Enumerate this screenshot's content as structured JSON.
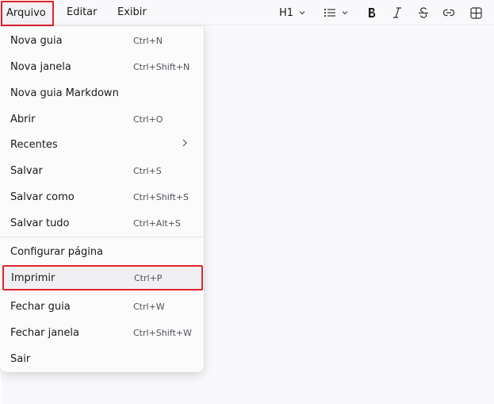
{
  "menubar": {
    "tabs": [
      {
        "label": "Arquivo"
      },
      {
        "label": "Editar"
      },
      {
        "label": "Exibir"
      }
    ]
  },
  "format_toolbar": {
    "heading_label": "H1",
    "icons": [
      "chevron-down-icon",
      "list-icon",
      "bold-icon",
      "italic-icon",
      "strikethrough-icon",
      "link-icon",
      "table-icon"
    ]
  },
  "file_menu": {
    "items": [
      {
        "label": "Nova guia",
        "shortcut": "Ctrl+N"
      },
      {
        "label": "Nova janela",
        "shortcut": "Ctrl+Shift+N"
      },
      {
        "label": "Nova guia Markdown",
        "shortcut": ""
      },
      {
        "label": "Abrir",
        "shortcut": "Ctrl+O"
      },
      {
        "label": "Recentes",
        "shortcut": ""
      },
      {
        "label": "Salvar",
        "shortcut": "Ctrl+S"
      },
      {
        "label": "Salvar como",
        "shortcut": "Ctrl+Shift+S"
      },
      {
        "label": "Salvar tudo",
        "shortcut": "Ctrl+Alt+S"
      },
      {
        "label": "Configurar página",
        "shortcut": ""
      },
      {
        "label": "Imprimir",
        "shortcut": "Ctrl+P"
      },
      {
        "label": "Fechar guia",
        "shortcut": "Ctrl+W"
      },
      {
        "label": "Fechar janela",
        "shortcut": "Ctrl+Shift+W"
      },
      {
        "label": "Sair",
        "shortcut": ""
      }
    ]
  },
  "colors": {
    "highlight": "#e0242b",
    "background": "#f9f9fb"
  }
}
